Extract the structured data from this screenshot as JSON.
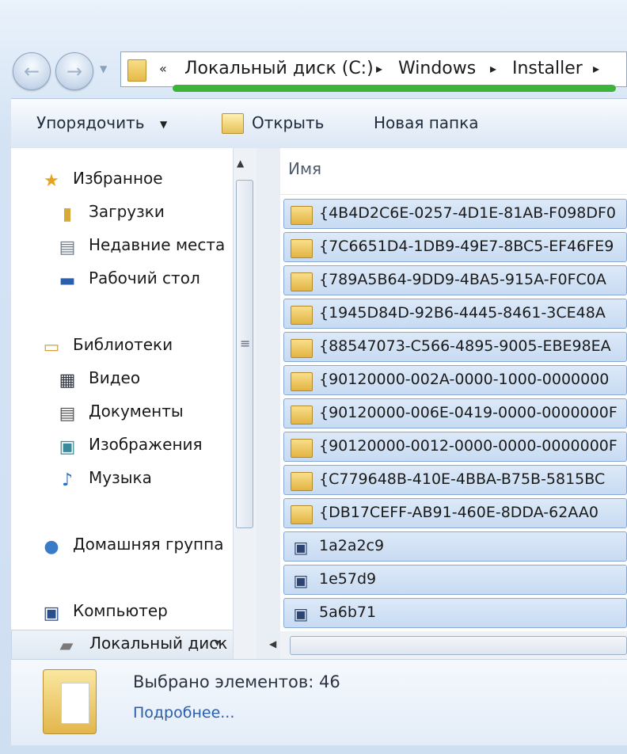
{
  "navigation": {
    "back_icon": "back-arrow-icon",
    "forward_icon": "forward-arrow-icon"
  },
  "address_bar": {
    "overflow_glyph": "«",
    "separator_glyph": "▸",
    "crumbs": [
      "Локальный диск (C:)",
      "Windows",
      "Installer"
    ],
    "highlight_color": "#3db33a"
  },
  "toolbar": {
    "organize_label": "Упорядочить",
    "open_label": "Открыть",
    "new_folder_label": "Новая папка"
  },
  "nav_pane": {
    "favorites": {
      "label": "Избранное",
      "icon": "star-icon"
    },
    "downloads": {
      "label": "Загрузки",
      "icon": "downloads-folder-icon"
    },
    "recent": {
      "label": "Недавние места",
      "icon": "recent-places-icon"
    },
    "desktop": {
      "label": "Рабочий стол",
      "icon": "desktop-icon"
    },
    "libraries": {
      "label": "Библиотеки",
      "icon": "libraries-icon"
    },
    "video": {
      "label": "Видео",
      "icon": "video-icon"
    },
    "documents": {
      "label": "Документы",
      "icon": "documents-icon"
    },
    "images": {
      "label": "Изображения",
      "icon": "images-icon"
    },
    "music": {
      "label": "Музыка",
      "icon": "music-icon"
    },
    "homegroup": {
      "label": "Домашняя группа",
      "icon": "homegroup-icon"
    },
    "computer": {
      "label": "Компьютер",
      "icon": "computer-icon"
    },
    "local_disk": {
      "label": "Локальный диск",
      "icon": "local-disk-icon"
    }
  },
  "file_list": {
    "column_name": "Имя",
    "rows": [
      {
        "name": "{4B4D2C6E-0257-4D1E-81AB-F098DF0",
        "type": "folder"
      },
      {
        "name": "{7C6651D4-1DB9-49E7-8BC5-EF46FE9",
        "type": "folder"
      },
      {
        "name": "{789A5B64-9DD9-4BA5-915A-F0FC0A",
        "type": "folder"
      },
      {
        "name": "{1945D84D-92B6-4445-8461-3CE48A",
        "type": "folder"
      },
      {
        "name": "{88547073-C566-4895-9005-EBE98EA",
        "type": "folder"
      },
      {
        "name": "{90120000-002A-0000-1000-0000000",
        "type": "folder"
      },
      {
        "name": "{90120000-006E-0419-0000-0000000F",
        "type": "folder"
      },
      {
        "name": "{90120000-0012-0000-0000-0000000F",
        "type": "folder"
      },
      {
        "name": "{C779648B-410E-4BBA-B75B-5815BC",
        "type": "folder"
      },
      {
        "name": "{DB17CEFF-AB91-460E-8DDA-62AA0",
        "type": "folder"
      },
      {
        "name": "1a2a2c9",
        "type": "msi"
      },
      {
        "name": "1e57d9",
        "type": "msi"
      },
      {
        "name": "5a6b71",
        "type": "msi"
      }
    ]
  },
  "details": {
    "count_text": "Выбрано элементов: 46",
    "more_link": "Подробнее..."
  }
}
